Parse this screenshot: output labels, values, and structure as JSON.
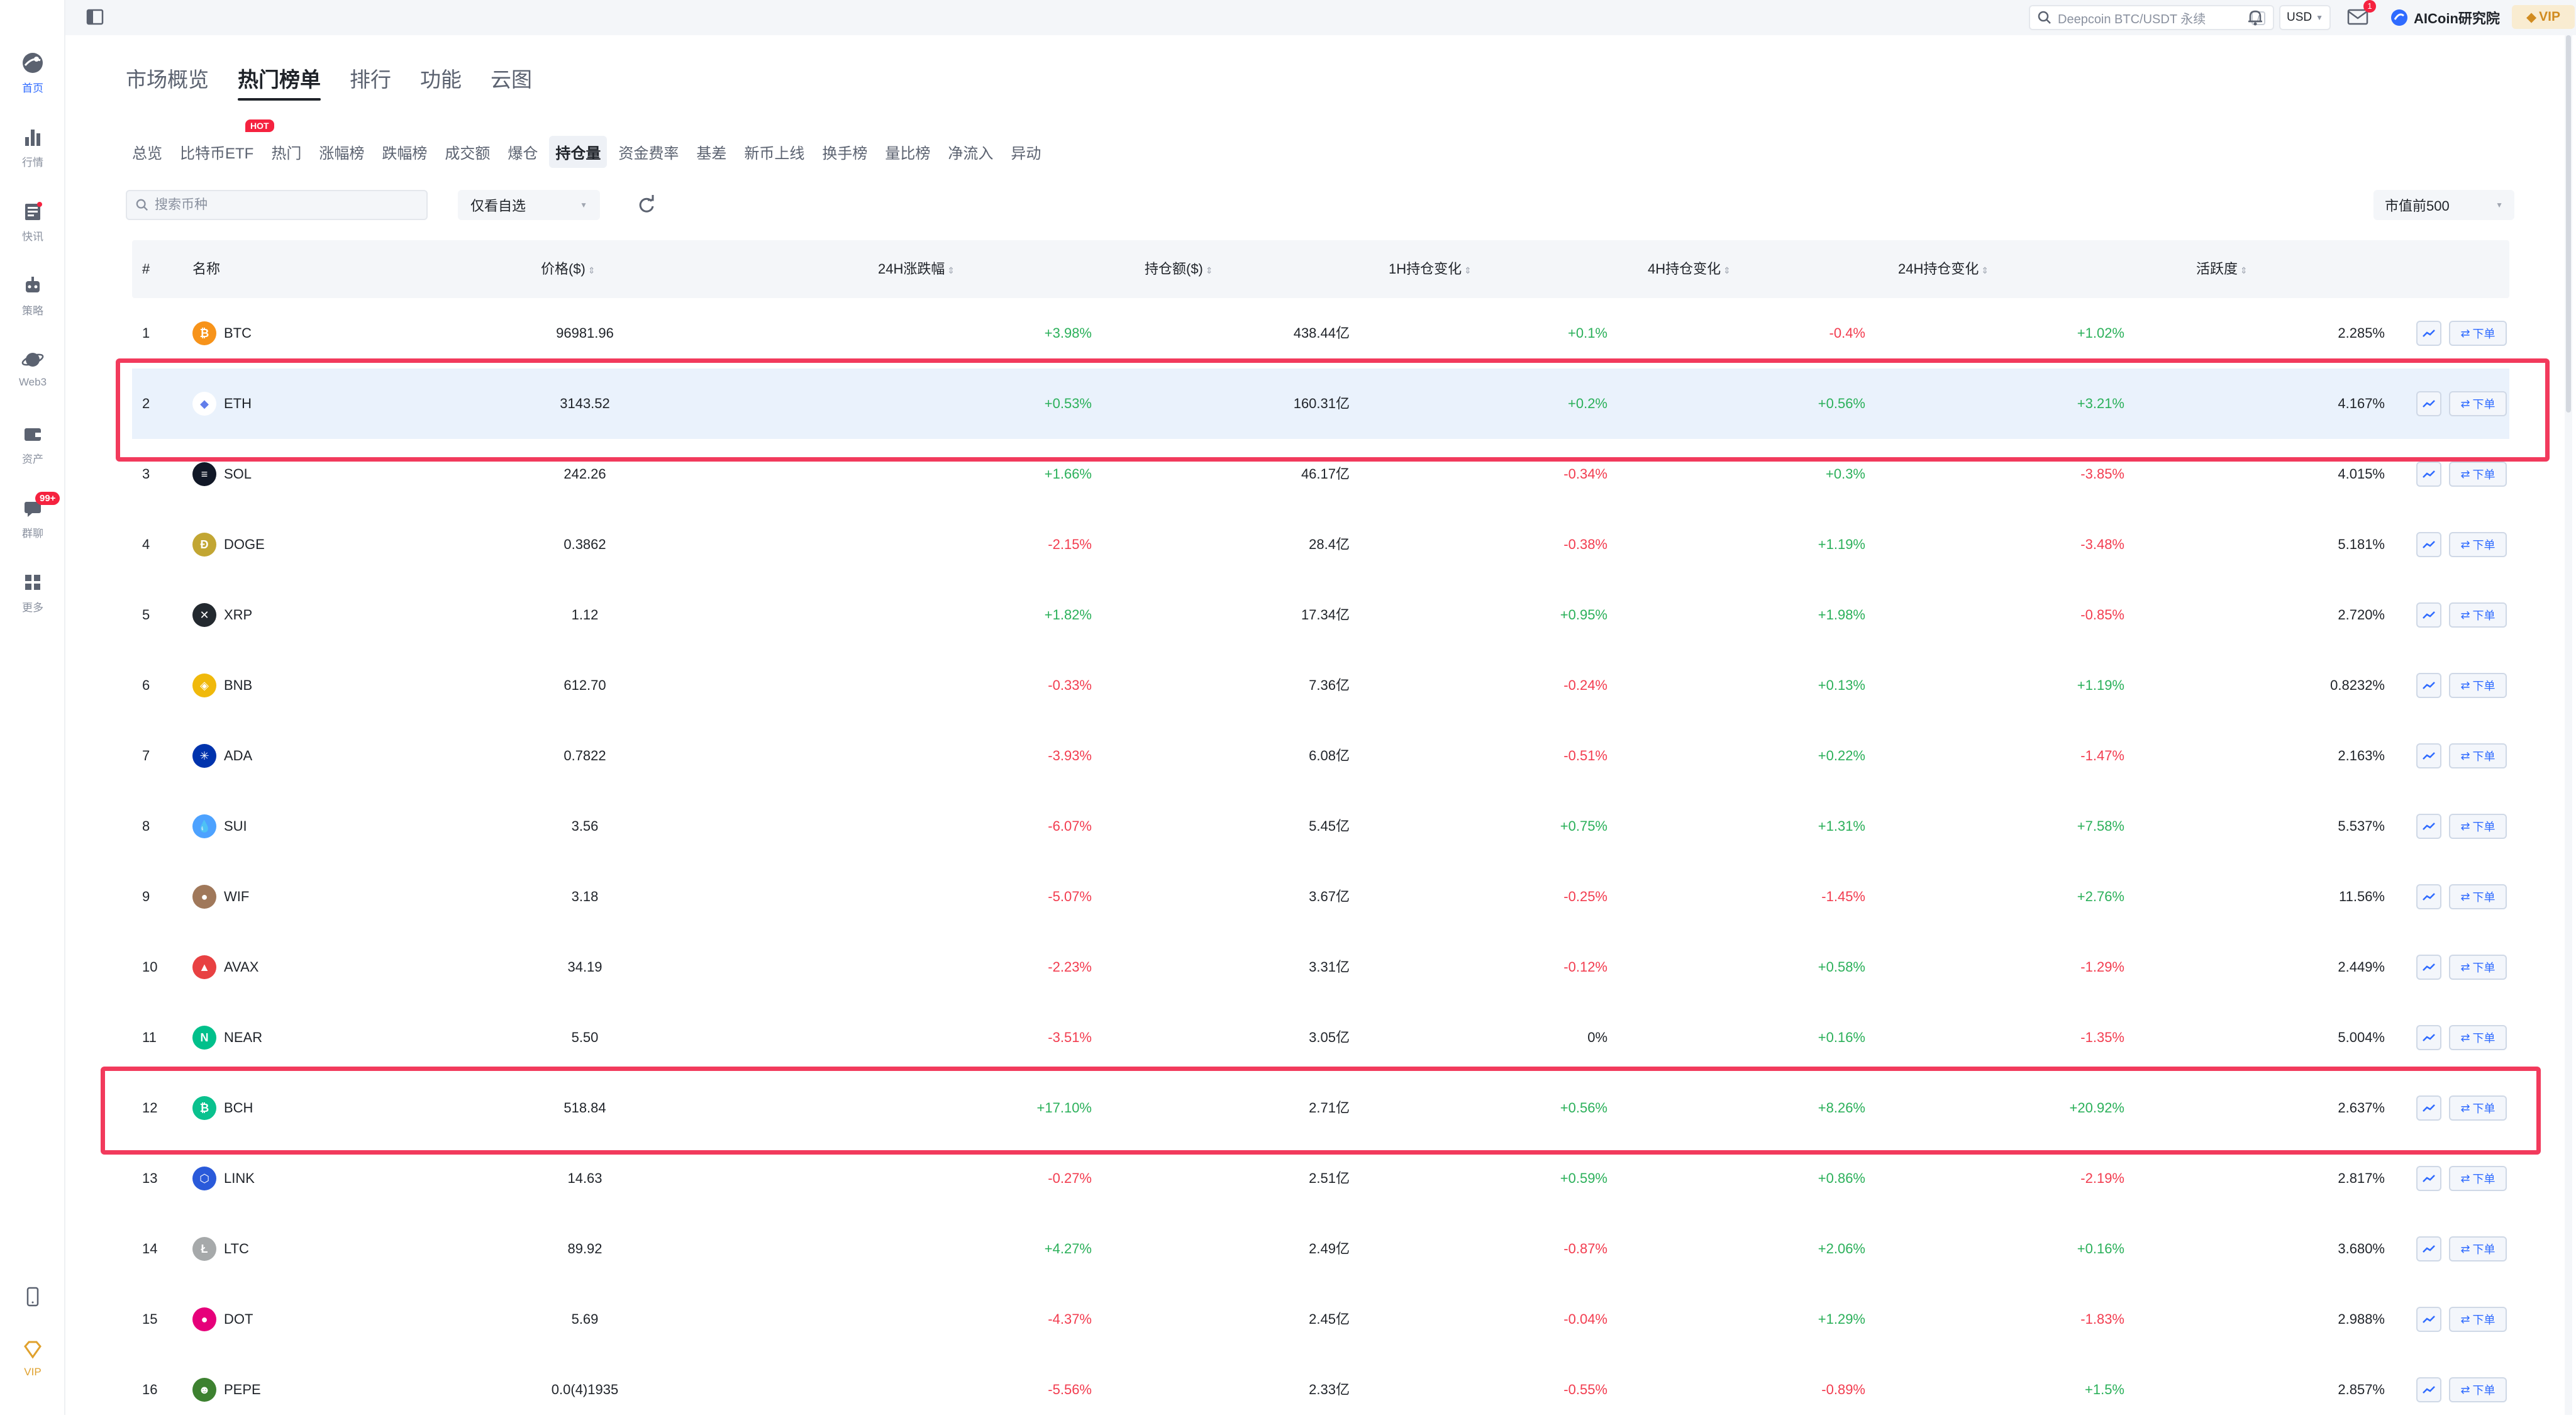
{
  "sidebar": {
    "items": [
      {
        "label": "首页",
        "icon": "home-globe-icon",
        "active": true
      },
      {
        "label": "行情",
        "icon": "bar-chart-icon"
      },
      {
        "label": "快讯",
        "icon": "news-icon"
      },
      {
        "label": "策略",
        "icon": "robot-icon"
      },
      {
        "label": "Web3",
        "icon": "web3-planet-icon"
      },
      {
        "label": "资产",
        "icon": "wallet-icon"
      },
      {
        "label": "群聊",
        "icon": "chat-icon",
        "badge": "99+"
      },
      {
        "label": "更多",
        "icon": "grid-icon"
      }
    ],
    "bottom": [
      {
        "icon": "phone-icon"
      },
      {
        "label": "VIP",
        "icon": "diamond-icon"
      }
    ]
  },
  "topbar": {
    "search_placeholder": "Deepcoin BTC/USDT 永续",
    "search_shortcut": "/",
    "currency": "USD",
    "mail_badge": "1",
    "username": "AICoin研究院",
    "vip_label": "VIP"
  },
  "main_tabs": [
    {
      "label": "市场概览"
    },
    {
      "label": "热门榜单",
      "active": true
    },
    {
      "label": "排行"
    },
    {
      "label": "功能"
    },
    {
      "label": "云图"
    }
  ],
  "sub_tabs": [
    {
      "label": "总览"
    },
    {
      "label": "比特币ETF"
    },
    {
      "label": "热门"
    },
    {
      "label": "涨幅榜"
    },
    {
      "label": "跌幅榜"
    },
    {
      "label": "成交额"
    },
    {
      "label": "爆仓"
    },
    {
      "label": "持仓量",
      "active": true
    },
    {
      "label": "资金费率"
    },
    {
      "label": "基差"
    },
    {
      "label": "新币上线"
    },
    {
      "label": "换手榜"
    },
    {
      "label": "量比榜"
    },
    {
      "label": "净流入"
    },
    {
      "label": "异动"
    }
  ],
  "hot_badge": "HOT",
  "filters": {
    "search_placeholder": "搜索币种",
    "fav_select": "仅看自选",
    "cap_select": "市值前500"
  },
  "table": {
    "columns": {
      "rank": "#",
      "name": "名称",
      "price": "价格($)",
      "change24h": "24H涨跌幅",
      "oi": "持仓额($)",
      "oi1h": "1H持仓变化",
      "oi4h": "4H持仓变化",
      "oi24h": "24H持仓变化",
      "activity": "活跃度"
    },
    "order_label": "下单",
    "rows": [
      {
        "rank": "1",
        "name": "BTC",
        "logo_color": "#f7931a",
        "logo_char": "₿",
        "price": "96981.96",
        "change24h": "+3.98%",
        "oi": "438.44亿",
        "oi1h": "+0.1%",
        "oi4h": "-0.4%",
        "oi24h": "+1.02%",
        "activity": "2.285%"
      },
      {
        "rank": "2",
        "name": "ETH",
        "logo_color": "#ffffff",
        "logo_char": "◆",
        "price": "3143.52",
        "change24h": "+0.53%",
        "oi": "160.31亿",
        "oi1h": "+0.2%",
        "oi4h": "+0.56%",
        "oi24h": "+3.21%",
        "activity": "4.167%"
      },
      {
        "rank": "3",
        "name": "SOL",
        "logo_color": "#111827",
        "logo_char": "≡",
        "price": "242.26",
        "change24h": "+1.66%",
        "oi": "46.17亿",
        "oi1h": "-0.34%",
        "oi4h": "+0.3%",
        "oi24h": "-3.85%",
        "activity": "4.015%"
      },
      {
        "rank": "4",
        "name": "DOGE",
        "logo_color": "#c2a633",
        "logo_char": "Ð",
        "price": "0.3862",
        "change24h": "-2.15%",
        "oi": "28.4亿",
        "oi1h": "-0.38%",
        "oi4h": "+1.19%",
        "oi24h": "-3.48%",
        "activity": "5.181%"
      },
      {
        "rank": "5",
        "name": "XRP",
        "logo_color": "#23292f",
        "logo_char": "✕",
        "price": "1.12",
        "change24h": "+1.82%",
        "oi": "17.34亿",
        "oi1h": "+0.95%",
        "oi4h": "+1.98%",
        "oi24h": "-0.85%",
        "activity": "2.720%"
      },
      {
        "rank": "6",
        "name": "BNB",
        "logo_color": "#f0b90b",
        "logo_char": "◈",
        "price": "612.70",
        "change24h": "-0.33%",
        "oi": "7.36亿",
        "oi1h": "-0.24%",
        "oi4h": "+0.13%",
        "oi24h": "+1.19%",
        "activity": "0.8232%"
      },
      {
        "rank": "7",
        "name": "ADA",
        "logo_color": "#0033ad",
        "logo_char": "✳",
        "price": "0.7822",
        "change24h": "-3.93%",
        "oi": "6.08亿",
        "oi1h": "-0.51%",
        "oi4h": "+0.22%",
        "oi24h": "-1.47%",
        "activity": "2.163%"
      },
      {
        "rank": "8",
        "name": "SUI",
        "logo_color": "#4da2ff",
        "logo_char": "💧",
        "price": "3.56",
        "change24h": "-6.07%",
        "oi": "5.45亿",
        "oi1h": "+0.75%",
        "oi4h": "+1.31%",
        "oi24h": "+7.58%",
        "activity": "5.537%"
      },
      {
        "rank": "9",
        "name": "WIF",
        "logo_color": "#a0785a",
        "logo_char": "●",
        "price": "3.18",
        "change24h": "-5.07%",
        "oi": "3.67亿",
        "oi1h": "-0.25%",
        "oi4h": "-1.45%",
        "oi24h": "+2.76%",
        "activity": "11.56%"
      },
      {
        "rank": "10",
        "name": "AVAX",
        "logo_color": "#e84142",
        "logo_char": "▲",
        "price": "34.19",
        "change24h": "-2.23%",
        "oi": "3.31亿",
        "oi1h": "-0.12%",
        "oi4h": "+0.58%",
        "oi24h": "-1.29%",
        "activity": "2.449%"
      },
      {
        "rank": "11",
        "name": "NEAR",
        "logo_color": "#00c08b",
        "logo_char": "N",
        "price": "5.50",
        "change24h": "-3.51%",
        "oi": "3.05亿",
        "oi1h": "0%",
        "oi4h": "+0.16%",
        "oi24h": "-1.35%",
        "activity": "5.004%"
      },
      {
        "rank": "12",
        "name": "BCH",
        "logo_color": "#0ac18e",
        "logo_char": "₿",
        "price": "518.84",
        "change24h": "+17.10%",
        "oi": "2.71亿",
        "oi1h": "+0.56%",
        "oi4h": "+8.26%",
        "oi24h": "+20.92%",
        "activity": "2.637%"
      },
      {
        "rank": "13",
        "name": "LINK",
        "logo_color": "#2a5ada",
        "logo_char": "⬡",
        "price": "14.63",
        "change24h": "-0.27%",
        "oi": "2.51亿",
        "oi1h": "+0.59%",
        "oi4h": "+0.86%",
        "oi24h": "-2.19%",
        "activity": "2.817%"
      },
      {
        "rank": "14",
        "name": "LTC",
        "logo_color": "#a6a9aa",
        "logo_char": "Ł",
        "price": "89.92",
        "change24h": "+4.27%",
        "oi": "2.49亿",
        "oi1h": "-0.87%",
        "oi4h": "+2.06%",
        "oi24h": "+0.16%",
        "activity": "3.680%"
      },
      {
        "rank": "15",
        "name": "DOT",
        "logo_color": "#e6007a",
        "logo_char": "●",
        "price": "5.69",
        "change24h": "-4.37%",
        "oi": "2.45亿",
        "oi1h": "-0.04%",
        "oi4h": "+1.29%",
        "oi24h": "-1.83%",
        "activity": "2.988%"
      },
      {
        "rank": "16",
        "name": "PEPE",
        "logo_color": "#3d8130",
        "logo_char": "☻",
        "price": "0.0(4)1935",
        "change24h": "-5.56%",
        "oi": "2.33亿",
        "oi1h": "-0.55%",
        "oi4h": "-0.89%",
        "oi24h": "+1.5%",
        "activity": "2.857%"
      }
    ]
  },
  "colors": {
    "up": "#2bb05a",
    "down": "#f23c4f",
    "accent": "#2f6bff",
    "highlight_box": "#f23a5c"
  }
}
